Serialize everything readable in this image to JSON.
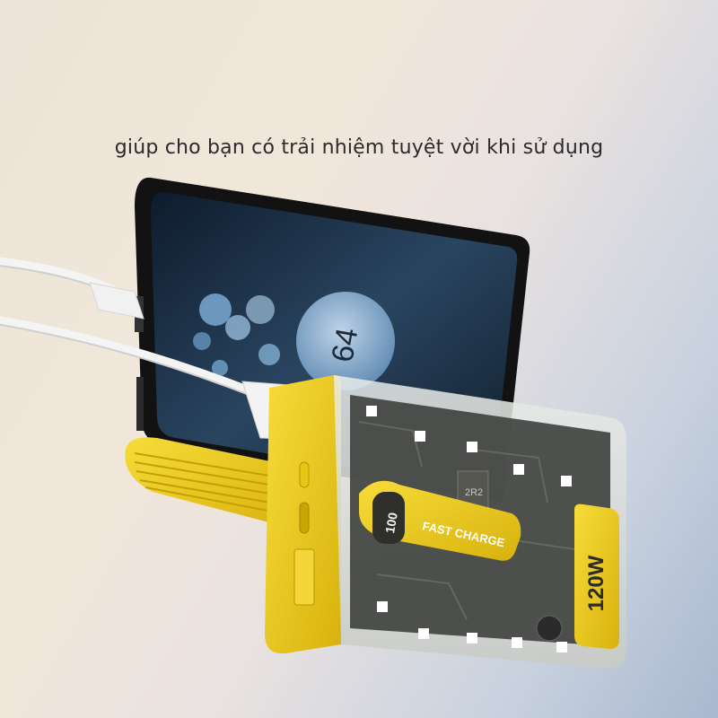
{
  "caption": "giúp cho bạn có trải nhiệm tuyệt vời khi sử dụng",
  "device": {
    "badge_label": "FAST CHARGE",
    "power_label": "120W",
    "display_value": "100",
    "chip_label": "2R2",
    "phone_charge_value": "64"
  },
  "colors": {
    "accent_yellow": "#f2cf1d",
    "phone_body": "#151515"
  }
}
